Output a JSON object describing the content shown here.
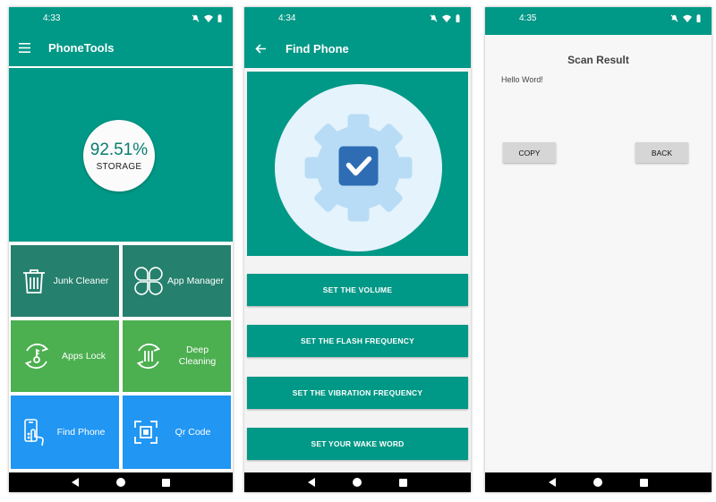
{
  "screens": {
    "home": {
      "time": "4:33",
      "title": "PhoneTools",
      "storage_percent": "92.51%",
      "storage_label": "STORAGE",
      "tiles": [
        {
          "label": "Junk Cleaner",
          "icon": "trash-icon"
        },
        {
          "label": "App Manager",
          "icon": "clover-icon"
        },
        {
          "label": "Apps Lock",
          "icon": "key-lock-icon"
        },
        {
          "label": "Deep Cleaning",
          "icon": "deep-clean-icon"
        },
        {
          "label": "Find Phone",
          "icon": "phone-touch-icon"
        },
        {
          "label": "Qr Code",
          "icon": "qr-icon"
        }
      ]
    },
    "find_phone": {
      "time": "4:34",
      "title": "Find Phone",
      "buttons": [
        "SET THE VOLUME",
        "SET THE FLASH FREQUENCY",
        "SET THE VIBRATION FREQUENCY",
        "SET YOUR WAKE WORD"
      ]
    },
    "scan_result": {
      "time": "4:35",
      "title": "Scan Result",
      "text": "Hello Word!",
      "copy_label": "COPY",
      "back_label": "BACK"
    }
  },
  "colors": {
    "primary": "#009886",
    "tile_dark": "#25806d",
    "tile_green": "#4caf50",
    "tile_blue": "#2196f3"
  }
}
